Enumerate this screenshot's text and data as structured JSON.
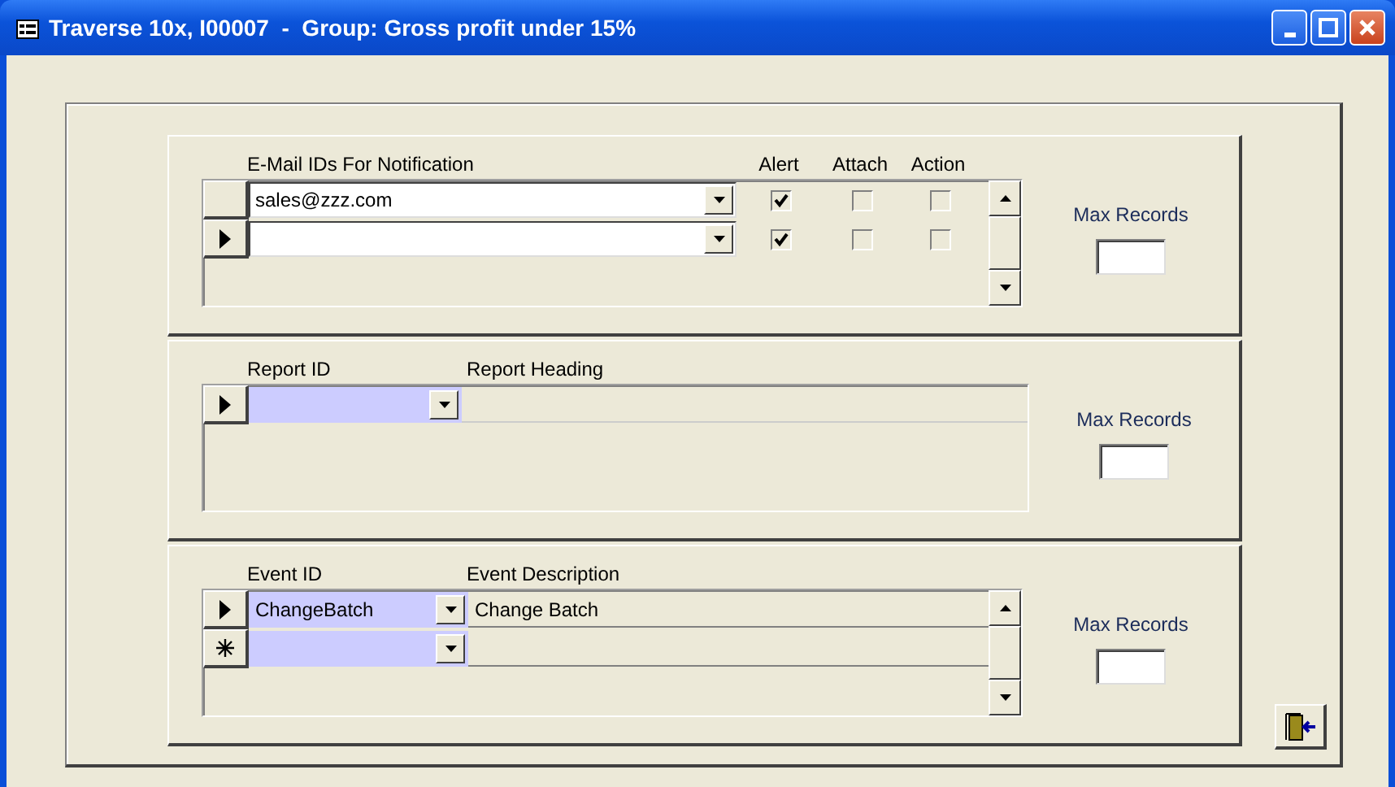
{
  "window": {
    "title": "Traverse 10x, I00007  -  Group: Gross profit under 15%"
  },
  "notifications": {
    "columns": [
      "E-Mail IDs For Notification",
      "Alert",
      "Attach",
      "Action"
    ],
    "rows": [
      {
        "current": false,
        "email": "sales@zzz.com",
        "alert": true,
        "attach": false,
        "action": false
      },
      {
        "current": true,
        "alert": true,
        "attach": false,
        "action": false
      }
    ],
    "max_records_label": "Max Records"
  },
  "reports": {
    "columns": [
      "Report ID",
      "Report Heading"
    ],
    "rows": [
      {
        "current": true
      }
    ],
    "max_records_label": "Max Records"
  },
  "events": {
    "columns": [
      "Event ID",
      "Event Description"
    ],
    "rows": [
      {
        "current": true,
        "new": false,
        "event_id": "ChangeBatch",
        "description": "Change Batch"
      },
      {
        "current": false,
        "new": true
      }
    ],
    "max_records_label": "Max Records"
  }
}
